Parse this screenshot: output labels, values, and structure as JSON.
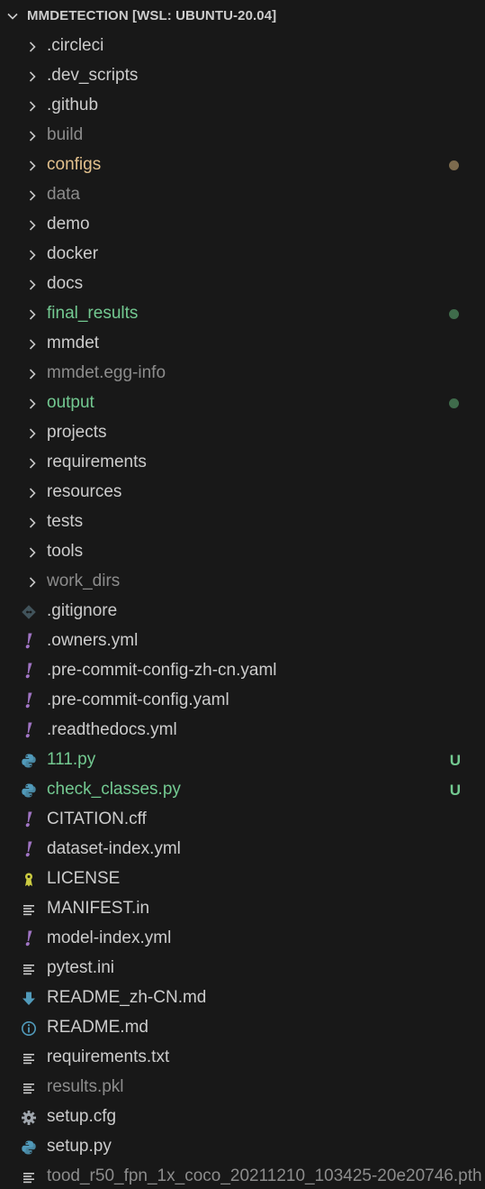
{
  "header": {
    "title": "MMDETECTION [WSL: UBUNTU-20.04]"
  },
  "colors": {
    "default": "#cccccc",
    "ignored": "#8c8c8c",
    "modified": "#e2c08d",
    "added": "#73c991",
    "modified_dot": "#7d6b4e",
    "added_dot": "#3f6b4b"
  },
  "items": [
    {
      "label": ".circleci",
      "kind": "folder",
      "status": "default"
    },
    {
      "label": ".dev_scripts",
      "kind": "folder",
      "status": "default"
    },
    {
      "label": ".github",
      "kind": "folder",
      "status": "default"
    },
    {
      "label": "build",
      "kind": "folder",
      "status": "ignored"
    },
    {
      "label": "configs",
      "kind": "folder",
      "status": "modified",
      "decoration": "dot"
    },
    {
      "label": "data",
      "kind": "folder",
      "status": "ignored"
    },
    {
      "label": "demo",
      "kind": "folder",
      "status": "default"
    },
    {
      "label": "docker",
      "kind": "folder",
      "status": "default"
    },
    {
      "label": "docs",
      "kind": "folder",
      "status": "default"
    },
    {
      "label": "final_results",
      "kind": "folder",
      "status": "added",
      "decoration": "dot"
    },
    {
      "label": "mmdet",
      "kind": "folder",
      "status": "default"
    },
    {
      "label": "mmdet.egg-info",
      "kind": "folder",
      "status": "ignored"
    },
    {
      "label": "output",
      "kind": "folder",
      "status": "added",
      "decoration": "dot"
    },
    {
      "label": "projects",
      "kind": "folder",
      "status": "default"
    },
    {
      "label": "requirements",
      "kind": "folder",
      "status": "default"
    },
    {
      "label": "resources",
      "kind": "folder",
      "status": "default"
    },
    {
      "label": "tests",
      "kind": "folder",
      "status": "default"
    },
    {
      "label": "tools",
      "kind": "folder",
      "status": "default"
    },
    {
      "label": "work_dirs",
      "kind": "folder",
      "status": "ignored"
    },
    {
      "label": ".gitignore",
      "kind": "file",
      "icon": "git-icon",
      "status": "default"
    },
    {
      "label": ".owners.yml",
      "kind": "file",
      "icon": "yaml-icon",
      "status": "default"
    },
    {
      "label": ".pre-commit-config-zh-cn.yaml",
      "kind": "file",
      "icon": "yaml-icon",
      "status": "default"
    },
    {
      "label": ".pre-commit-config.yaml",
      "kind": "file",
      "icon": "yaml-icon",
      "status": "default"
    },
    {
      "label": ".readthedocs.yml",
      "kind": "file",
      "icon": "yaml-icon",
      "status": "default"
    },
    {
      "label": "111.py",
      "kind": "file",
      "icon": "python-icon",
      "status": "added",
      "decoration": "U"
    },
    {
      "label": "check_classes.py",
      "kind": "file",
      "icon": "python-icon",
      "status": "added",
      "decoration": "U"
    },
    {
      "label": "CITATION.cff",
      "kind": "file",
      "icon": "yaml-icon",
      "status": "default"
    },
    {
      "label": "dataset-index.yml",
      "kind": "file",
      "icon": "yaml-icon",
      "status": "default"
    },
    {
      "label": "LICENSE",
      "kind": "file",
      "icon": "license-icon",
      "status": "default"
    },
    {
      "label": "MANIFEST.in",
      "kind": "file",
      "icon": "text-lines-icon",
      "status": "default"
    },
    {
      "label": "model-index.yml",
      "kind": "file",
      "icon": "yaml-icon",
      "status": "default"
    },
    {
      "label": "pytest.ini",
      "kind": "file",
      "icon": "text-lines-icon",
      "status": "default"
    },
    {
      "label": "README_zh-CN.md",
      "kind": "file",
      "icon": "download-arrow-icon",
      "status": "default"
    },
    {
      "label": "README.md",
      "kind": "file",
      "icon": "info-icon",
      "status": "default"
    },
    {
      "label": "requirements.txt",
      "kind": "file",
      "icon": "text-lines-icon",
      "status": "default"
    },
    {
      "label": "results.pkl",
      "kind": "file",
      "icon": "text-lines-icon",
      "status": "ignored"
    },
    {
      "label": "setup.cfg",
      "kind": "file",
      "icon": "gear-icon",
      "status": "default"
    },
    {
      "label": "setup.py",
      "kind": "file",
      "icon": "python-icon",
      "status": "default"
    },
    {
      "label": "tood_r50_fpn_1x_coco_20211210_103425-20e20746.pth",
      "kind": "file",
      "icon": "text-lines-icon",
      "status": "ignored"
    }
  ]
}
